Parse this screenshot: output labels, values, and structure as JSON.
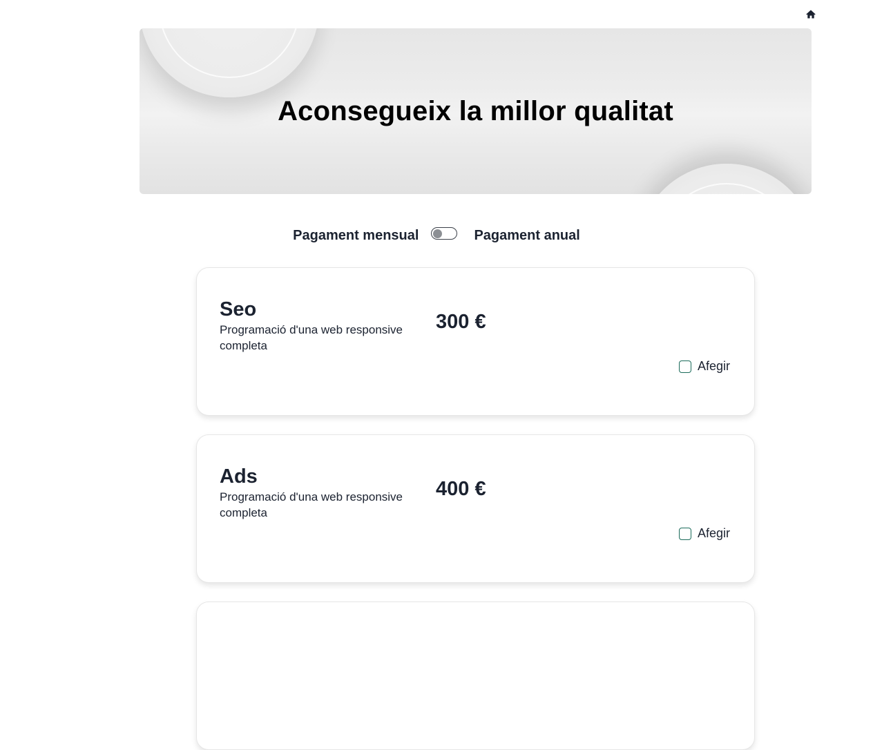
{
  "nav": {
    "home_icon": "home-icon"
  },
  "hero": {
    "title": "Aconsegueix la millor qualitat"
  },
  "billing": {
    "monthly_label": "Pagament mensual",
    "annual_label": "Pagament anual",
    "annual_enabled": false
  },
  "services": [
    {
      "name": "Seo",
      "description": "Programació d'una web responsive completa",
      "price": "300 €",
      "add_label": "Afegir",
      "checked": false
    },
    {
      "name": "Ads",
      "description": "Programació d'una web responsive completa",
      "price": "400 €",
      "add_label": "Afegir",
      "checked": false
    }
  ],
  "colors": {
    "text": "#1b2230",
    "checkbox_border": "#1a6b5a",
    "toggle_knob": "#8c8f94"
  }
}
